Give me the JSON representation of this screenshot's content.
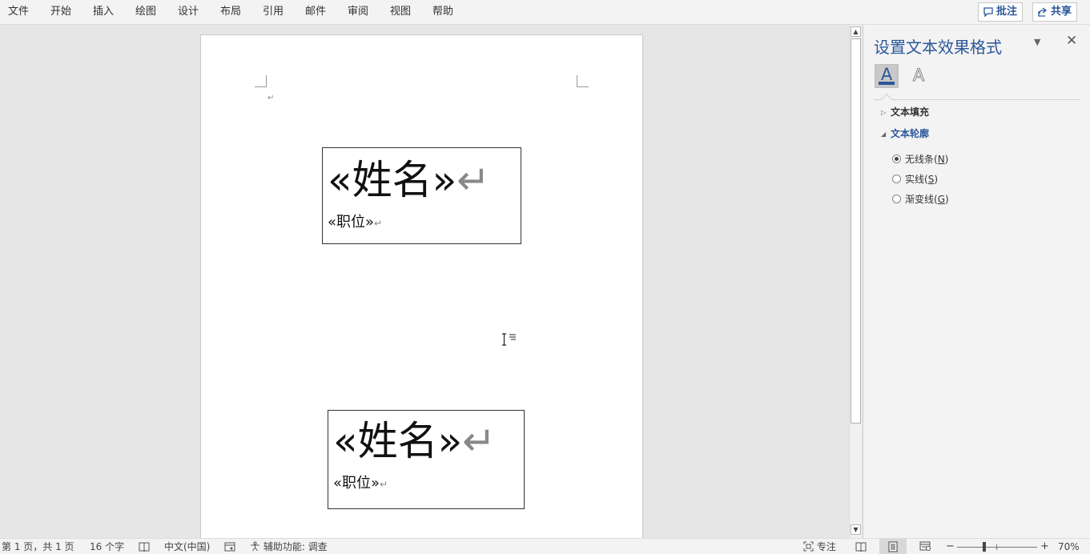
{
  "menu": {
    "items": [
      "文件",
      "开始",
      "插入",
      "绘图",
      "设计",
      "布局",
      "引用",
      "邮件",
      "审阅",
      "视图",
      "帮助"
    ],
    "comments_label": "批注",
    "share_label": "共享"
  },
  "document": {
    "paragraph_mark": "↵",
    "labels": [
      {
        "name": "«姓名»",
        "position": "«职位»"
      },
      {
        "name": "«姓名»",
        "position": "«职位»"
      }
    ]
  },
  "pane": {
    "title": "设置文本效果格式",
    "tabs": [
      {
        "name": "text-fill-outline-tab",
        "glyph": "A",
        "selected": true
      },
      {
        "name": "text-effects-tab",
        "glyph": "A",
        "selected": false
      }
    ],
    "sections": {
      "fill": {
        "label": "文本填充",
        "expanded": false
      },
      "outline": {
        "label": "文本轮廓",
        "expanded": true
      }
    },
    "outline_options": [
      {
        "label": "无线条(",
        "key": "N",
        "close": ")",
        "checked": true
      },
      {
        "label": "实线(",
        "key": "S",
        "close": ")",
        "checked": false
      },
      {
        "label": "渐变线(",
        "key": "G",
        "close": ")",
        "checked": false
      }
    ]
  },
  "status": {
    "page": "第 1 页，共 1 页",
    "words": "16 个字",
    "language": "中文(中国)",
    "accessibility": "辅助功能: 调查",
    "focus": "专注",
    "zoom": "70%",
    "zoom_percent": 70
  },
  "colors": {
    "accent": "#2b579a",
    "pane_bg": "#f3f3f3",
    "canvas_bg": "#e6e6e6"
  }
}
